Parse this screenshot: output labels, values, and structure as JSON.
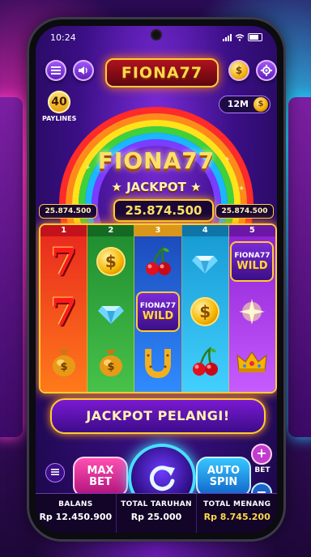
{
  "status_bar": {
    "time": "10:24"
  },
  "header": {
    "logo": "FIONA77",
    "menu_icon": "hamburger-icon",
    "sound_icon": "speaker-icon",
    "coin_icon": "coin-icon",
    "settings_icon": "gear-icon"
  },
  "paylines": {
    "count": "40",
    "label": "PAYLINES"
  },
  "credits": {
    "value": "12M"
  },
  "jackpot": {
    "title": "FIONA77",
    "subtitle": "JACKPOT",
    "amount": "25.874.500",
    "left_amount": "25.874.500",
    "right_amount": "25.874.500"
  },
  "reels": [
    {
      "number": "1",
      "symbols": [
        "seven",
        "seven",
        "money-bag"
      ]
    },
    {
      "number": "2",
      "symbols": [
        "coin",
        "diamond",
        "money-bag"
      ]
    },
    {
      "number": "3",
      "symbols": [
        "cherry",
        "wild",
        "horseshoe"
      ]
    },
    {
      "number": "4",
      "symbols": [
        "diamond",
        "coin",
        "cherry"
      ]
    },
    {
      "number": "5",
      "symbols": [
        "wild",
        "sparkle",
        "crown"
      ]
    }
  ],
  "wild_symbol": {
    "line1": "FIONA77",
    "line2": "WILD"
  },
  "seven_glyph": "7",
  "coin_glyph": "$",
  "banner": {
    "text": "JACKPOT PELANGI!"
  },
  "controls": {
    "max_bet_line1": "MAX",
    "max_bet_line2": "BET",
    "auto_spin_line1": "AUTO",
    "auto_spin_line2": "SPIN",
    "bet_label": "BET",
    "plus": "+",
    "minus": "−"
  },
  "footer": {
    "balance_label": "BALANS",
    "balance_value": "Rp 12.450.900",
    "total_bet_label": "TOTAL TARUHAN",
    "total_bet_value": "Rp 25.000",
    "total_win_label": "TOTAL MENANG",
    "total_win_value": "Rp 8.745.200"
  },
  "colors": {
    "gold": "#ffcc33",
    "neon_pink": "#ff3cc8",
    "neon_blue": "#48e0ff",
    "purple": "#3b0f86"
  }
}
